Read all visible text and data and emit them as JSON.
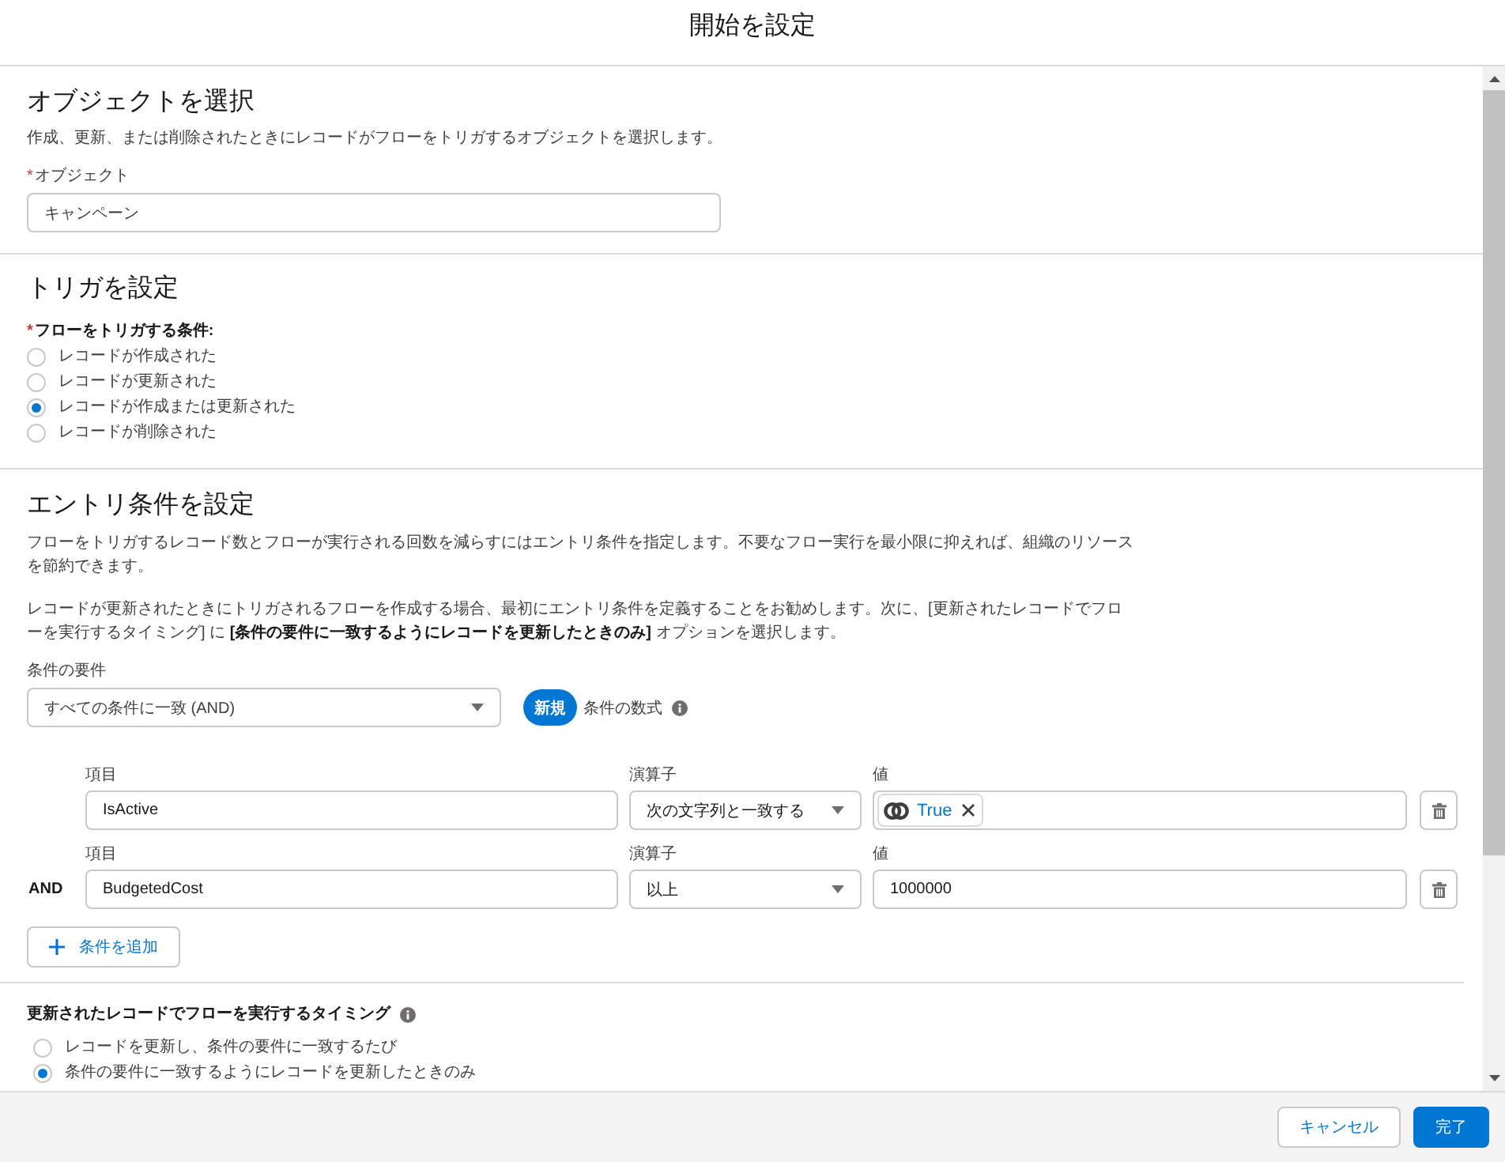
{
  "modal": {
    "title": "開始を設定"
  },
  "object_section": {
    "heading": "オブジェクトを選択",
    "description": "作成、更新、または削除されたときにレコードがフローをトリガするオブジェクトを選択します。",
    "field": {
      "required_mark": "*",
      "label": "オブジェクト",
      "value": "キャンペーン"
    }
  },
  "trigger_section": {
    "heading": "トリガを設定",
    "required_mark": "*",
    "label": "フローをトリガする条件:",
    "options": [
      {
        "label": "レコードが作成された",
        "selected": false
      },
      {
        "label": "レコードが更新された",
        "selected": false
      },
      {
        "label": "レコードが作成または更新された",
        "selected": true
      },
      {
        "label": "レコードが削除された",
        "selected": false
      }
    ]
  },
  "entry_section": {
    "heading": "エントリ条件を設定",
    "paragraphs": [
      "フローをトリガするレコード数とフローが実行される回数を減らすにはエントリ条件を指定します。不要なフロー実行を最小限に抑えれば、組織のリソースを節約できます。",
      "レコードが更新されたときにトリガされるフローを作成する場合、最初にエントリ条件を定義することをお勧めします。次に、[更新されたレコードでフローを実行するタイミング] に **[条件の要件に一致するようにレコードを更新したときのみ]** オプションを選択します。"
    ],
    "requirement": {
      "label": "条件の要件",
      "value": "すべての条件に一致 (AND)"
    },
    "new_badge": "新規",
    "formula_label": "条件の数式",
    "conditions": [
      {
        "field_label": "項目",
        "field_value": "IsActive",
        "operator_label": "演算子",
        "operator_value": "次の文字列と一致する",
        "value_label": "値",
        "value": {
          "kind": "pill",
          "text": "True"
        }
      },
      {
        "connector": "AND",
        "field_label": "項目",
        "field_value": "BudgetedCost",
        "operator_label": "演算子",
        "operator_value": "以上",
        "value_label": "値",
        "value": {
          "kind": "text",
          "text": "1000000"
        }
      }
    ],
    "add_button": "条件を追加"
  },
  "timing_section": {
    "label": "更新されたレコードでフローを実行するタイミング",
    "options": [
      {
        "label": "レコードを更新し、条件の要件に一致するたび",
        "selected": false
      },
      {
        "label": "条件の要件に一致するようにレコードを更新したときのみ",
        "selected": true
      }
    ]
  },
  "footer": {
    "buttons": [
      {
        "label": "キャンセル",
        "kind": "neutral"
      },
      {
        "label": "完了",
        "kind": "brand"
      }
    ]
  }
}
